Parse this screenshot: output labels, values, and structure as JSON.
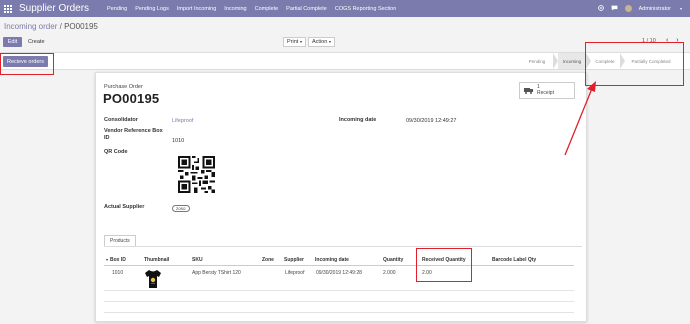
{
  "topnav": {
    "title": "Supplier Orders",
    "menu": [
      "Pending",
      "Pending Logs",
      "Import Incoming",
      "Incoming",
      "Complete",
      "Partial Complete",
      "COGS Reporting Section"
    ],
    "user": "Administrator",
    "icons": [
      "apps-icon",
      "bug-icon",
      "chat-icon",
      "avatar"
    ]
  },
  "breadcrumb": {
    "parent": "Incoming order",
    "separator": "/",
    "current": "PO00195"
  },
  "toolbar": {
    "edit": "Edit",
    "create": "Create",
    "print": "Print",
    "action": "Action"
  },
  "pager": {
    "value": "1 / 10"
  },
  "actions": {
    "receive": "Recieve orders"
  },
  "statusbar": {
    "stages": [
      "Pending",
      "Incoming",
      "Complete",
      "Partially Completed"
    ],
    "active": "Incoming"
  },
  "form": {
    "label": "Purchase Order",
    "name": "PO00195",
    "smart_button": {
      "count": "1",
      "label": "Receipt"
    },
    "consolidator_label": "Consolidator",
    "consolidator": "Lifeproof",
    "vendor_ref_label": "Vendor Reference Box ID",
    "vendor_ref": "1010",
    "qr_label": "QR Code",
    "actual_supplier_label": "Actual Supplier",
    "actual_supplier": "zoso",
    "incoming_date_label": "Incoming date",
    "incoming_date": "09/30/2019 12:49:27"
  },
  "tabs": {
    "products": "Products"
  },
  "table": {
    "headers": [
      "Box ID",
      "Thumbnail",
      "SKU",
      "Zone",
      "Supplier",
      "Incoming date",
      "Quantity",
      "Received Quantity",
      "Barcode Label Qty"
    ],
    "rows": [
      {
        "box_id": "1010",
        "sku": "App Bersty TShirt 120",
        "zone": "",
        "supplier": "Lifeproof",
        "incoming_date": "09/30/2019 12:49:28",
        "quantity": "2.000",
        "received_quantity": "2.00",
        "barcode_qty": ""
      }
    ]
  },
  "colors": {
    "brand": "#7c7bad",
    "annotation": "#e0202a"
  }
}
